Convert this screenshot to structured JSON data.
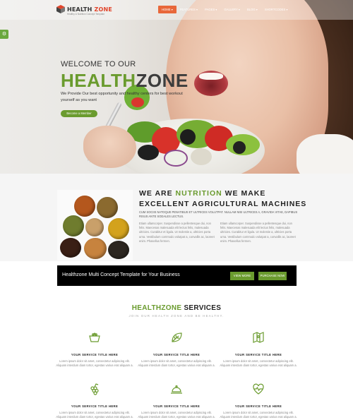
{
  "header": {
    "brand_left": "HEALTH",
    "brand_right": "ZONE",
    "tagline": "Healthy & Nutrition Concept Template",
    "nav": [
      "HOME",
      "FEATURES",
      "PAGES",
      "GALLERY",
      "BLOG",
      "SHORTCODES"
    ]
  },
  "hero": {
    "pre_title": "WELCOME TO OUR",
    "title_green": "HEALTH",
    "title_dark": "ZONE",
    "subtitle": "We Provide Our best opportunity and healthy centers for best workout yourself as you want",
    "cta_label": "Become a Member"
  },
  "about": {
    "title_part1": "WE ARE ",
    "title_highlight": "NUTRITION",
    "title_part2": " WE MAKE EXCELLENT AGRICULTURAL MACHINES",
    "lead": "CUM SOCIIS NATOQUE PENATIBUS ET ULTRICES VOLUTPAT. NULLAM NISI ULTRICES A, GRAVIDA VITAE, DAPIBUS RISUS ANTE SODALES LECTUS.",
    "col1": "Etiam ullamcorper. Suspendisse a pellentesque dui, non felis. Maecenas malesuada elit lectus felis, malesuada ultricies. Curabitur et ligula. Ut molestie a, ultricies porta urna. Vestibulum commodo volutpat a, convallis ac, laoreet enim. Phasellus fermen.",
    "col2": "Etiam ullamcorper. Suspendisse a pellentesque dui, non felis. Maecenas malesuada elit lectus felis, malesuada ultricies. Curabitur et ligula. Ut molestie a, ultricies porta urna. Vestibulum commodo volutpat a, convallis ac, laoreet enim. Phasellus fermen."
  },
  "cta": {
    "text": "Healthzone Multi Concept Template for Your Business",
    "btn1": "VIEW MORE",
    "btn2": "PURCHASE NOW"
  },
  "services": {
    "title_green": "HEALTHZONE",
    "title_dark": " SERVICES",
    "subtitle": "JOIN OUR HEALTH ZONE AND BE HEALTHY.",
    "items": [
      {
        "icon": "basket-icon",
        "name": "YOUR SERVICE TITLE HERE",
        "text": "Lorem ipsum dolor sit amet, consectetur adipiscing elit. Aliquam interdum diam tortor, egestas varius erat aliquam a."
      },
      {
        "icon": "leaf-icon",
        "name": "YOUR SERVICE TITLE HERE",
        "text": "Lorem ipsum dolor sit amet, consectetur adipiscing elit. Aliquam interdum diam tortor, egestas varius erat aliquam a."
      },
      {
        "icon": "map-icon",
        "name": "YOUR SERVICE TITLE HERE",
        "text": "Lorem ipsum dolor sit amet, consectetur adipiscing elit. Aliquam interdum diam tortor, egestas varius erat aliquam a."
      },
      {
        "icon": "grapes-icon",
        "name": "YOUR SERVICE TITLE HERE",
        "text": "Lorem ipsum dolor sit amet, consectetur adipiscing elit. Aliquam interdum diam tortor, egestas varius erat aliquam a."
      },
      {
        "icon": "cloche-icon",
        "name": "YOUR SERVICE TITLE HERE",
        "text": "Lorem ipsum dolor sit amet, consectetur adipiscing elit. Aliquam interdum diam tortor, egestas varius erat aliquam a."
      },
      {
        "icon": "heart-pulse-icon",
        "name": "YOUR SERVICE TITLE HERE",
        "text": "Lorem ipsum dolor sit amet, consectetur adipiscing elit. Aliquam interdum diam tortor, egestas varius erat aliquam a."
      }
    ]
  },
  "colors": {
    "accent_green": "#6a9b2e",
    "nav_active": "#e8673a",
    "logo_red": "#e1442a"
  }
}
